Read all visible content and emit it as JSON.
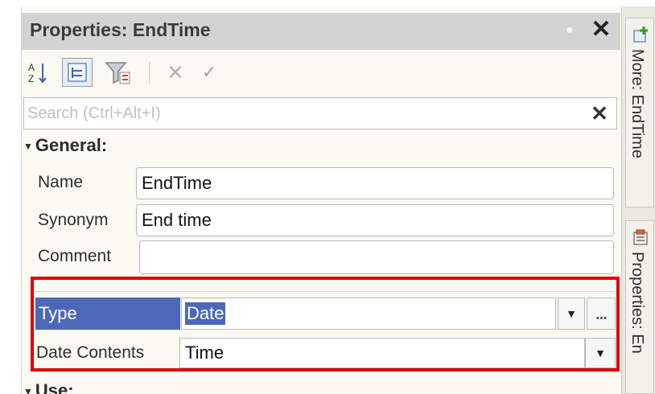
{
  "panel": {
    "title": "Properties: EndTime",
    "toolbar": {
      "sort_icon_text": "A\nZ",
      "cancel_glyph": "✕",
      "ok_glyph": "✓"
    },
    "search": {
      "placeholder": "Search (Ctrl+Alt+I)",
      "value": "",
      "clear_glyph": "✕"
    },
    "sections": {
      "general": "General:",
      "use": "Use:"
    },
    "fields": {
      "name_label": "Name",
      "name_value": "EndTime",
      "synonym_label": "Synonym",
      "synonym_value": "End time",
      "comment_label": "Comment",
      "comment_value": "",
      "type_label": "Type",
      "type_value": "Date",
      "type_more": "...",
      "date_contents_label": "Date Contents",
      "date_contents_value": "Time"
    }
  },
  "side_tabs": [
    {
      "label": "More: EndTime",
      "icon": "add-green-icon"
    },
    {
      "label": "Properties: En",
      "icon": "properties-icon"
    }
  ],
  "colors": {
    "selection": "#4c68b8",
    "highlight_box": "#e00000",
    "titlebar": "#d3d3d3"
  }
}
